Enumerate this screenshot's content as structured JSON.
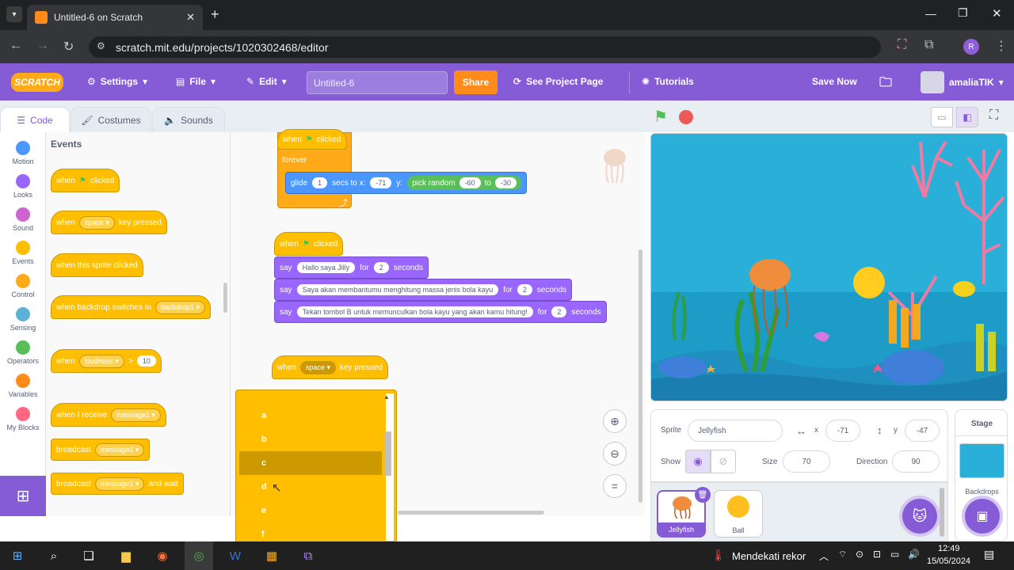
{
  "browser": {
    "tab_title": "Untitled-6 on Scratch",
    "url": "scratch.mit.edu/projects/1020302468/editor",
    "profile": "R"
  },
  "menu": {
    "logo": "SCRATCH",
    "settings": "Settings",
    "file": "File",
    "edit": "Edit",
    "project_title": "Untitled-6",
    "share": "Share",
    "see_project": "See Project Page",
    "tutorials": "Tutorials",
    "save_now": "Save Now",
    "username": "amaliaTIK"
  },
  "tabs": {
    "code": "Code",
    "costumes": "Costumes",
    "sounds": "Sounds"
  },
  "categories": [
    {
      "label": "Motion",
      "color": "#4c97ff"
    },
    {
      "label": "Looks",
      "color": "#9966ff"
    },
    {
      "label": "Sound",
      "color": "#cf63cf"
    },
    {
      "label": "Events",
      "color": "#ffbf00"
    },
    {
      "label": "Control",
      "color": "#ffab19"
    },
    {
      "label": "Sensing",
      "color": "#5cb1d6"
    },
    {
      "label": "Operators",
      "color": "#59c059"
    },
    {
      "label": "Variables",
      "color": "#ff8c1a"
    },
    {
      "label": "My Blocks",
      "color": "#ff6680"
    }
  ],
  "palette": {
    "heading": "Events",
    "b1_when": "when",
    "b1_clicked": "clicked",
    "b2_when": "when",
    "b2_key": "space",
    "b2_rest": "key pressed",
    "b3": "when this sprite clicked",
    "b4": "when backdrop switches to",
    "b4_opt": "backdrop1",
    "b5_when": "when",
    "b5_opt": "loudness",
    "b5_gt": ">",
    "b5_val": "10",
    "b6": "when I receive",
    "b6_opt": "message1",
    "b7": "broadcast",
    "b7_opt": "message1",
    "b8": "broadcast",
    "b8_opt": "message1",
    "b8_rest": "and wait"
  },
  "script1": {
    "when": "when",
    "clicked": "clicked",
    "forever": "forever",
    "glide": "glide",
    "secs": "1",
    "secs_to": "secs to x:",
    "x": "-71",
    "y_lbl": "y:",
    "pick": "pick random",
    "r1": "-60",
    "to": "to",
    "r2": "-30"
  },
  "script2": {
    "when": "when",
    "clicked": "clicked",
    "say1": "say",
    "msg1": "Hallo saya Jilly",
    "for1": "for",
    "s1": "2",
    "sec1": "seconds",
    "say2": "say",
    "msg2": "Saya akan membantumu menghitung massa jenis bola kayu",
    "for2": "for",
    "s2": "2",
    "sec2": "seconds",
    "say3": "say",
    "msg3": "Tekan tombol B untuk memunculkan bola kayu yang akan kamu hitung!",
    "for3": "for",
    "s3": "2",
    "sec3": "seconds"
  },
  "script3": {
    "when": "when",
    "key": "space",
    "rest": "key pressed"
  },
  "dropdown": {
    "items": [
      "a",
      "b",
      "c",
      "d",
      "e",
      "f"
    ],
    "selected": "c"
  },
  "sprite": {
    "label": "Sprite",
    "name": "Jellyfish",
    "x": "-71",
    "y": "-47",
    "x_lbl": "x",
    "y_lbl": "y",
    "show": "Show",
    "size_lbl": "Size",
    "size": "70",
    "dir_lbl": "Direction",
    "dir": "90"
  },
  "sprites": [
    {
      "name": "Jellyfish"
    },
    {
      "name": "Ball"
    }
  ],
  "stage_panel": {
    "title": "Stage",
    "backdrops": "Backdrops"
  },
  "taskbar": {
    "weather": "Mendekati rekor",
    "time": "12:49",
    "date": "15/05/2024"
  }
}
